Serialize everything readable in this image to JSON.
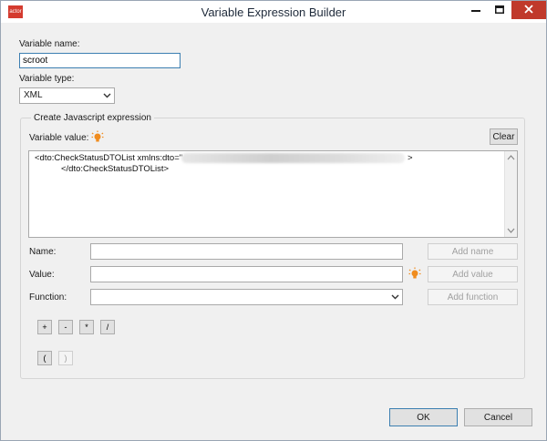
{
  "window": {
    "title": "Variable Expression Builder",
    "app_icon_text": "actor"
  },
  "form": {
    "variable_name_label": "Variable name:",
    "variable_name_value": "scroot",
    "variable_type_label": "Variable type:",
    "variable_type_value": "XML"
  },
  "expression": {
    "group_title": "Create Javascript expression",
    "variable_value_label": "Variable value:",
    "clear_label": "Clear",
    "line1_start": "<dto:CheckStatusDTOList xmlns:dto=\"",
    "line1_end": ">",
    "line2": "</dto:CheckStatusDTOList>"
  },
  "builder": {
    "name_label": "Name:",
    "value_label": "Value:",
    "function_label": "Function:",
    "name_value": "",
    "value_value": "",
    "function_value": "",
    "add_name_label": "Add name",
    "add_value_label": "Add value",
    "add_function_label": "Add function"
  },
  "operators": [
    "+",
    "-",
    "*",
    "/"
  ],
  "parens": [
    "(",
    ")"
  ],
  "footer": {
    "ok_label": "OK",
    "cancel_label": "Cancel"
  },
  "colors": {
    "accent": "#3c7fb1",
    "close_button": "#c0392b",
    "app_icon": "#d43b2f",
    "bulb": "#f08c1e"
  }
}
